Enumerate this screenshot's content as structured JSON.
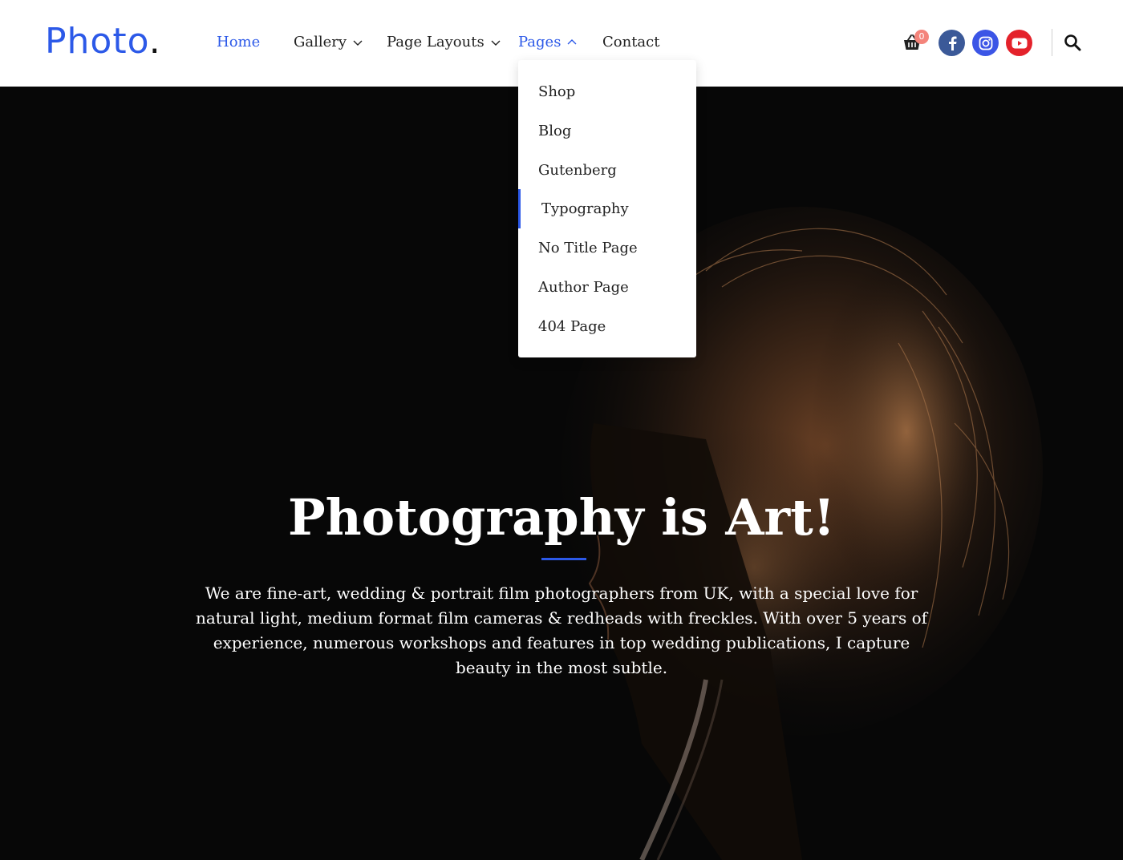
{
  "header": {
    "logo": {
      "word": "Photo",
      "dot": "."
    },
    "nav": [
      {
        "label": "Home",
        "active": true,
        "dropdown": false
      },
      {
        "label": "Gallery",
        "active": false,
        "dropdown": true
      },
      {
        "label": "Page Layouts",
        "active": false,
        "dropdown": true
      },
      {
        "label": "Pages",
        "active": true,
        "dropdown": true,
        "open": true
      },
      {
        "label": "Contact",
        "active": false,
        "dropdown": false
      }
    ],
    "cart": {
      "icon": "shopping-basket-icon",
      "count": "0"
    },
    "social": [
      {
        "name": "facebook-icon",
        "color": "#3b5998"
      },
      {
        "name": "instagram-icon",
        "color": "#3b55e6"
      },
      {
        "name": "youtube-icon",
        "color": "#e4222b"
      }
    ],
    "search_icon": "search-icon"
  },
  "dropdown": {
    "items": [
      {
        "label": "Shop"
      },
      {
        "label": "Blog"
      },
      {
        "label": "Gutenberg"
      },
      {
        "label": "Typography",
        "highlighted": true
      },
      {
        "label": "No Title Page"
      },
      {
        "label": "Author Page"
      },
      {
        "label": "404 Page"
      }
    ]
  },
  "hero": {
    "title": "Photography is Art!",
    "text": "We are fine-art, wedding & portrait film photographers from UK, with a special love for natural light, medium format film cameras & redheads with freckles. With over 5 years of experience, numerous workshops and features in top wedding publications, I capture beauty in the most subtle."
  },
  "colors": {
    "accent": "#2c59e8",
    "badge": "#f4847b",
    "hero_bg": "#070707"
  }
}
